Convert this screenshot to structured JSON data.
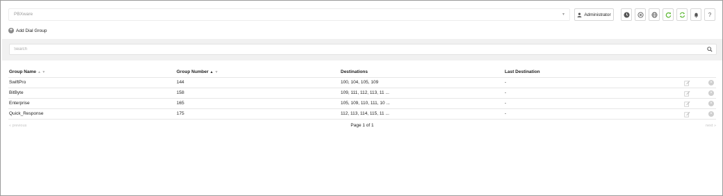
{
  "header": {
    "pbx_select_value": "PBXware",
    "user_label": "Administrator",
    "icons": [
      "clock-icon",
      "circle-x-icon",
      "globe-icon",
      "refresh-icon",
      "sync-icon",
      "bell-icon",
      "help-icon"
    ],
    "help_label": "?"
  },
  "toolbar": {
    "add_label": "Add Dial Group"
  },
  "search": {
    "placeholder": "Search"
  },
  "table": {
    "columns": [
      "Group Name",
      "Group Number",
      "Destinations",
      "Last Destination"
    ],
    "rows": [
      {
        "name": "SwiftPro",
        "number": "144",
        "destinations": "100, 104, 105, 109",
        "last": "-"
      },
      {
        "name": "BitByte",
        "number": "158",
        "destinations": "109, 111, 112, 113, 11 ...",
        "last": "-"
      },
      {
        "name": "Enterprise",
        "number": "165",
        "destinations": "105, 109, 110, 111, 10 ...",
        "last": "-"
      },
      {
        "name": "Quick_Response",
        "number": "175",
        "destinations": "112, 113, 114, 115, 11 ...",
        "last": "-"
      }
    ]
  },
  "pager": {
    "prev": "« previous",
    "page": "Page 1 of 1",
    "next": "next »"
  },
  "colors": {
    "green": "#5cb833",
    "band": "#f1f1f1",
    "border": "#d7d7d7"
  }
}
